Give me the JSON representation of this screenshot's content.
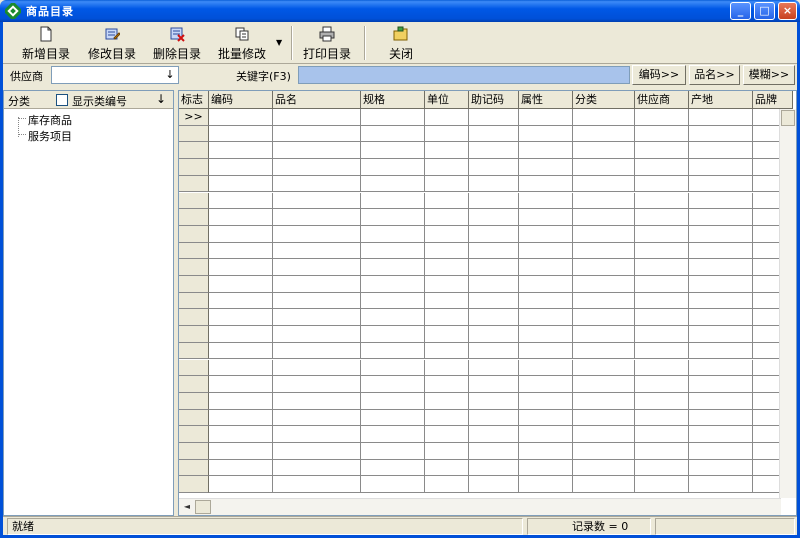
{
  "window": {
    "title": "商品目录"
  },
  "toolbar": {
    "items": [
      {
        "label": "新增目录",
        "icon": "new-document-icon"
      },
      {
        "label": "修改目录",
        "icon": "edit-icon"
      },
      {
        "label": "删除目录",
        "icon": "delete-icon"
      },
      {
        "label": "批量修改",
        "icon": "batch-edit-icon"
      },
      {
        "label": "打印目录",
        "icon": "printer-icon"
      },
      {
        "label": "关闭",
        "icon": "folder-close-icon"
      }
    ]
  },
  "filter": {
    "supplier_label": "供应商",
    "supplier_value": "",
    "dropdown_glyph": "↓",
    "keyword_label": "关键字(F3)",
    "keyword_value": "",
    "code_button": "编码>>",
    "name_button": "品名>>",
    "fuzzy_button": "模糊>>"
  },
  "left_panel": {
    "category_label": "分类",
    "show_code_label": "显示类编号",
    "show_code_checked": false,
    "sort_glyph": "↓",
    "tree": [
      "库存商品",
      "服务项目"
    ]
  },
  "grid": {
    "columns": [
      "标志",
      "编码",
      "品名",
      "规格",
      "单位",
      "助记码",
      "属性",
      "分类",
      "供应商",
      "产地",
      "品牌"
    ],
    "current_row_marker": ">>",
    "rows": []
  },
  "status": {
    "ready": "就绪",
    "record_count_label": "记录数 = 0"
  }
}
